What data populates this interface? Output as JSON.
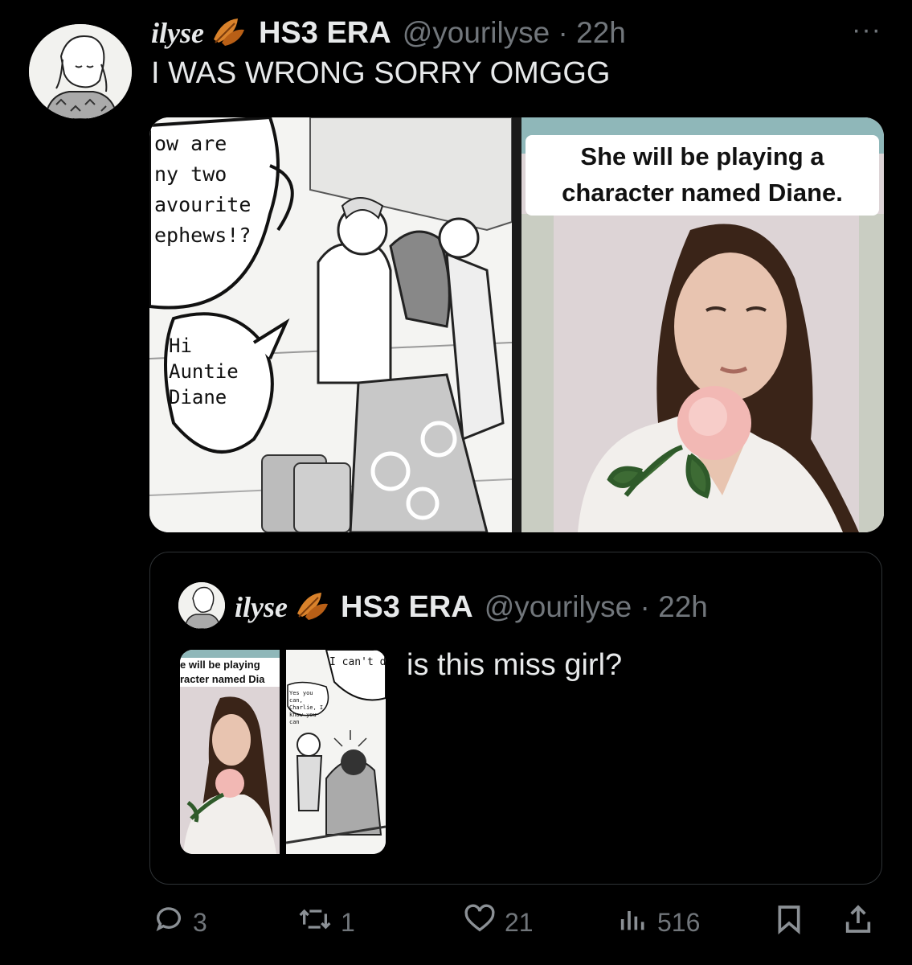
{
  "tweet": {
    "display_name": "ilyse",
    "era_text": "HS3 ERA",
    "handle_time": "@yourilyse · 22h",
    "more_label": "···",
    "text": "I WAS WRONG SORRY OMGGG",
    "image_left": {
      "bubble1": [
        "ow are",
        "ny two",
        "avourite",
        "ephews!?"
      ],
      "bubble2": [
        "Hi",
        "Auntie",
        "Diane"
      ]
    },
    "image_right": {
      "caption_line1": "She will be playing a",
      "caption_line2": "character named Diane."
    }
  },
  "quote": {
    "display_name": "ilyse",
    "era_text": "HS3 ERA",
    "handle_time": "@yourilyse · 22h",
    "text": "is this miss girl?",
    "thumb1": {
      "caption_line1": "e will be playing",
      "caption_line2": "racter named Dia"
    },
    "thumb2": {
      "bubble_top": "I can't do",
      "bubble_small": "Yes you can, Charlie, I know you can"
    }
  },
  "actions": {
    "replies": "3",
    "reposts": "1",
    "likes": "21",
    "views": "516"
  },
  "colors": {
    "background": "#000000",
    "text": "#e7e9ea",
    "muted": "#71767b",
    "border": "#2f3336"
  },
  "icons": [
    "reply-icon",
    "repost-icon",
    "like-icon",
    "views-icon",
    "bookmark-icon",
    "share-icon",
    "leaf-emoji-icon",
    "more-icon"
  ]
}
